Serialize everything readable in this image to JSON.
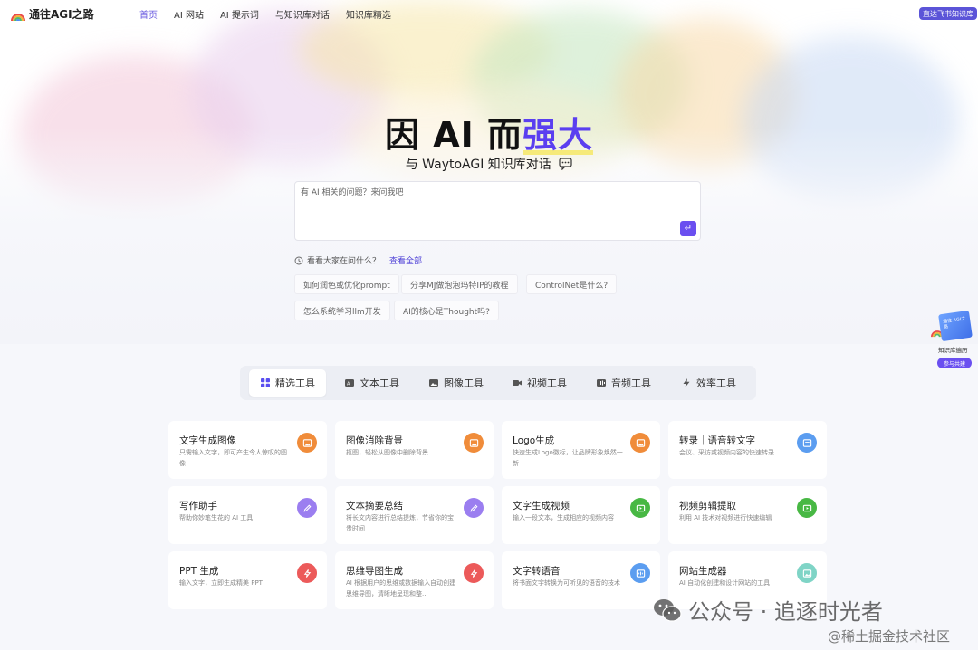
{
  "brand": {
    "name": "通往AGI之路"
  },
  "nav": {
    "items": [
      "首页",
      "AI 网站",
      "AI 提示词",
      "与知识库对话",
      "知识库精选"
    ],
    "active_index": 0
  },
  "header": {
    "feishu_button": "直达飞书知识库"
  },
  "hero": {
    "title_main": "因 AI 而",
    "title_accent": "强大",
    "subtitle": "与 WaytoAGI 知识库对话"
  },
  "ask": {
    "placeholder": "有 AI 相关的问题？来问我吧"
  },
  "popular": {
    "label": "看看大家在问什么？",
    "view_all": "查看全部",
    "questions": [
      "如何润色或优化prompt",
      "分享MJ做泡泡玛特IP的教程",
      "ControlNet是什么?",
      "怎么系统学习llm开发",
      "AI的核心是Thought吗?"
    ]
  },
  "side_widget": {
    "book_text": "通往 AGI之路",
    "label": "知识库遍历",
    "button": "参与共建"
  },
  "tabs": [
    {
      "label": "精选工具",
      "icon": "grid-icon",
      "active": true
    },
    {
      "label": "文本工具",
      "icon": "text-icon"
    },
    {
      "label": "图像工具",
      "icon": "image-icon"
    },
    {
      "label": "视频工具",
      "icon": "video-icon"
    },
    {
      "label": "音频工具",
      "icon": "audio-icon"
    },
    {
      "label": "效率工具",
      "icon": "lightning-icon"
    }
  ],
  "tools": [
    {
      "title": "文字生成图像",
      "desc": "只需输入文字，即可产生令人惊叹的图像",
      "icon": "image-icon",
      "color": "#f08c3a"
    },
    {
      "title": "图像消除背景",
      "desc": "抠图，轻松从图像中删除背景",
      "icon": "image-icon",
      "color": "#f08c3a"
    },
    {
      "title": "Logo生成",
      "desc": "快速生成Logo徽标，让品牌形象焕然一新",
      "icon": "image-icon",
      "color": "#f08c3a"
    },
    {
      "title": "转录｜语音转文字",
      "desc": "会议、采访或视频内容的快速转录",
      "icon": "transcribe-icon",
      "color": "#5b9df0"
    },
    {
      "title": "写作助手",
      "desc": "帮助你妙笔生花的 AI 工具",
      "icon": "pen-icon",
      "color": "#9b7ef0"
    },
    {
      "title": "文本摘要总结",
      "desc": "将长文内容进行总结提炼，节省你的宝贵时间",
      "icon": "pen-icon",
      "color": "#9b7ef0"
    },
    {
      "title": "文字生成视频",
      "desc": "输入一段文本，生成相应的视频内容",
      "icon": "video-icon",
      "color": "#48b844"
    },
    {
      "title": "视频剪辑提取",
      "desc": "利用 AI 技术对视频进行快速编辑",
      "icon": "video-icon",
      "color": "#48b844"
    },
    {
      "title": "PPT 生成",
      "desc": "输入文字，立即生成精美 PPT",
      "icon": "lightning-icon",
      "color": "#ec5a5a"
    },
    {
      "title": "思维导图生成",
      "desc": "AI 根据用户的思维或数据输入自动创建思维导图，清晰地呈现和整...",
      "icon": "lightning-icon",
      "color": "#ec5a5a"
    },
    {
      "title": "文字转语音",
      "desc": "将书面文字转换为可听见的语音的技术",
      "icon": "audio-icon",
      "color": "#5b9df0"
    },
    {
      "title": "网站生成器",
      "desc": "AI 自动化创建和设计网站的工具",
      "icon": "image-icon",
      "color": "#7fd4c6"
    }
  ],
  "watermark": {
    "line1": "公众号 · 追逐时光者",
    "line2": "@稀土掘金技术社区"
  }
}
